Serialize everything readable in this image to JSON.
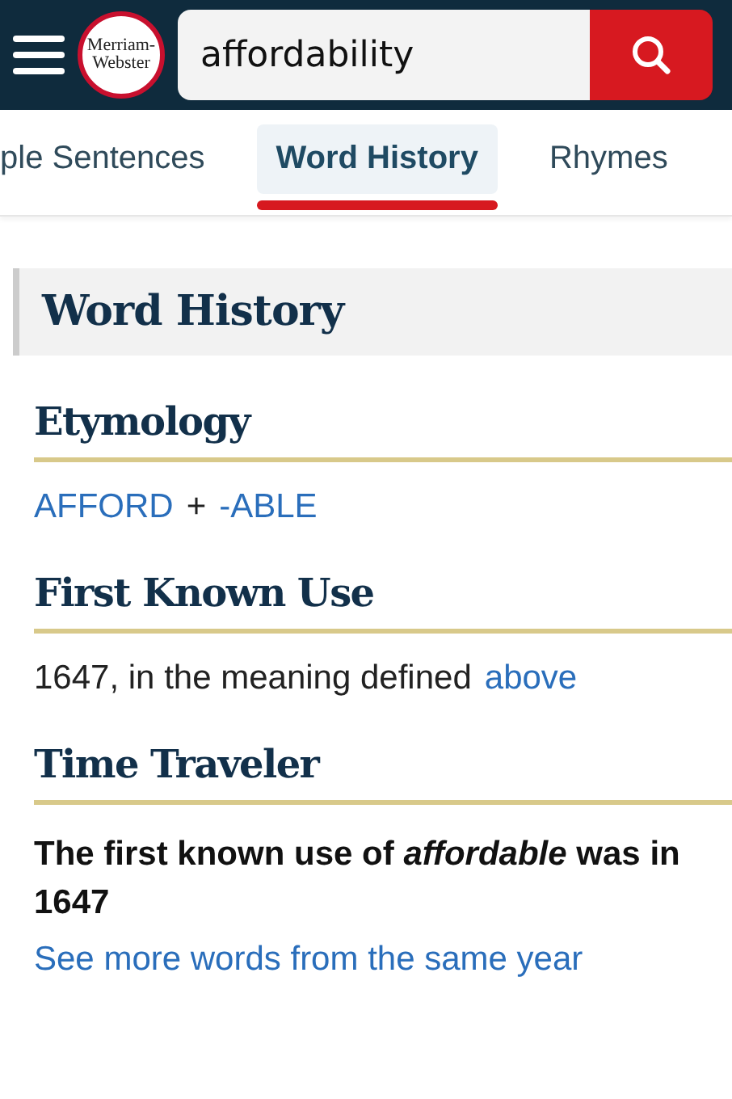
{
  "header": {
    "logo_lines": [
      "Merriam-",
      "Webster"
    ],
    "search": {
      "value": "affordability"
    }
  },
  "tabs": [
    {
      "label": "ple Sentences",
      "selected": false
    },
    {
      "label": "Word History",
      "selected": true
    },
    {
      "label": "Rhymes",
      "selected": false
    }
  ],
  "section_title": "Word History",
  "blocks": [
    {
      "heading": "Etymology",
      "parts": [
        {
          "kind": "link",
          "text": "AFFORD"
        },
        {
          "kind": "text",
          "text": "+"
        },
        {
          "kind": "link",
          "text": "-ABLE"
        }
      ]
    },
    {
      "heading": "First Known Use",
      "parts": [
        {
          "kind": "text",
          "text": "1647, in the meaning defined"
        },
        {
          "kind": "link",
          "text": "above"
        }
      ]
    },
    {
      "heading": "Time Traveler",
      "parts": [
        {
          "kind": "strong",
          "text": "The first known use of *affordable* was in 1647"
        },
        {
          "kind": "block-link",
          "text": "See more words from the same year"
        }
      ]
    }
  ]
}
